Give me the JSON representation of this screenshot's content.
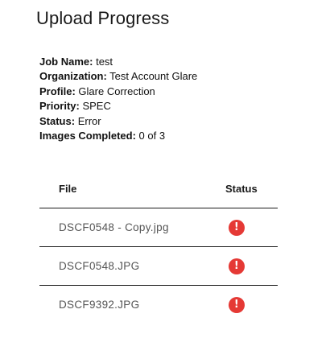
{
  "page": {
    "title": "Upload Progress"
  },
  "job": {
    "fields": [
      {
        "label": "Job Name:",
        "value": "test"
      },
      {
        "label": "Organization:",
        "value": "Test Account Glare"
      },
      {
        "label": "Profile:",
        "value": "Glare Correction"
      },
      {
        "label": "Priority:",
        "value": "SPEC"
      },
      {
        "label": "Status:",
        "value": "Error"
      },
      {
        "label": "Images Completed:",
        "value": "0 of 3"
      }
    ]
  },
  "table": {
    "headers": {
      "file": "File",
      "status": "Status"
    },
    "rows": [
      {
        "file": "DSCF0548 - Copy.jpg",
        "status": "error",
        "status_icon": "!",
        "status_icon_name": "error-icon"
      },
      {
        "file": "DSCF0548.JPG",
        "status": "error",
        "status_icon": "!",
        "status_icon_name": "error-icon"
      },
      {
        "file": "DSCF9392.JPG",
        "status": "error",
        "status_icon": "!",
        "status_icon_name": "error-icon"
      }
    ]
  },
  "colors": {
    "error": "#e53935",
    "text": "#111111",
    "muted_text": "#555555",
    "divider": "#1a1a1a"
  }
}
